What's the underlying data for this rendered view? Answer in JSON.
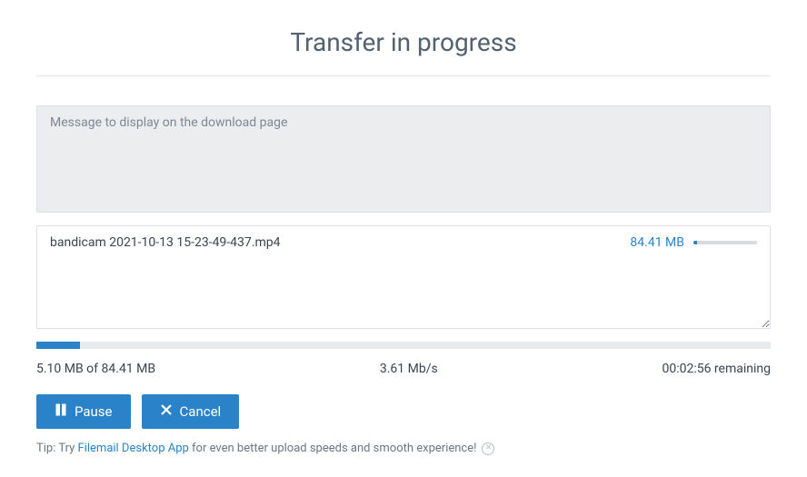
{
  "title": "Transfer in progress",
  "message": {
    "placeholder": "Message to display on the download page",
    "value": ""
  },
  "files": [
    {
      "name": "bandicam 2021-10-13 15-23-49-437.mp4",
      "size": "84.41 MB",
      "progress_percent": 6
    }
  ],
  "overall_progress_percent": 6,
  "stats": {
    "uploaded": "5.10 MB of 84.41 MB",
    "speed": "3.61 Mb/s",
    "remaining": "00:02:56 remaining"
  },
  "buttons": {
    "pause": "Pause",
    "cancel": "Cancel"
  },
  "tip": {
    "prefix": "Tip: Try ",
    "link_text": "Filemail Desktop App",
    "suffix": " for even better upload speeds and smooth experience!"
  }
}
